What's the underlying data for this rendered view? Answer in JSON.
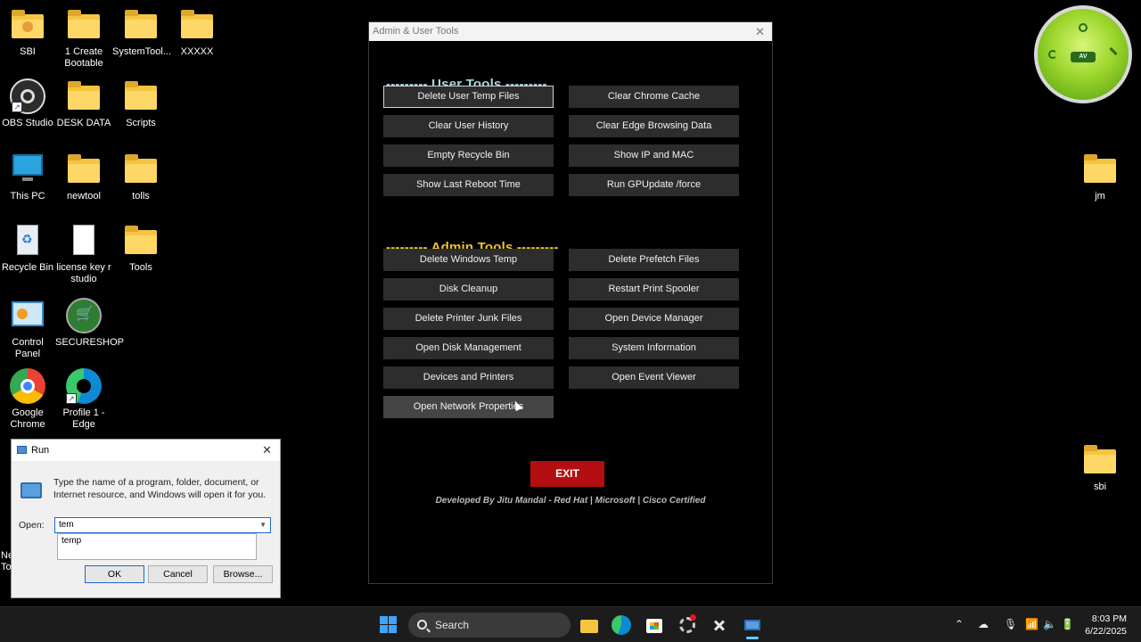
{
  "desktop": {
    "icons": [
      {
        "label": "SBI"
      },
      {
        "label": "1 Create Bootable"
      },
      {
        "label": "SystemTool..."
      },
      {
        "label": "XXXXX"
      },
      {
        "label": "OBS Studio"
      },
      {
        "label": "DESK DATA"
      },
      {
        "label": "Scripts"
      },
      {
        "label": "This PC"
      },
      {
        "label": "newtool"
      },
      {
        "label": "tolls"
      },
      {
        "label": "Recycle Bin"
      },
      {
        "label": "license key r studio"
      },
      {
        "label": "Tools"
      },
      {
        "label": "Control Panel"
      },
      {
        "label": "SECURESHOP"
      },
      {
        "label": "Google Chrome"
      },
      {
        "label": "Profile 1 - Edge"
      },
      {
        "label": "jm"
      },
      {
        "label": "sbi"
      },
      {
        "label": "Ne To"
      }
    ]
  },
  "gadget": {
    "badge": "AV"
  },
  "tool_window": {
    "title": "Admin & User Tools",
    "user_section": "--------- User Tools ---------",
    "admin_section": "--------- Admin Tools ---------",
    "user_buttons": [
      "Delete User Temp Files",
      "Clear Chrome Cache",
      "Clear User History",
      "Clear Edge Browsing Data",
      "Empty Recycle Bin",
      "Show IP and MAC",
      "Show Last Reboot Time",
      "Run GPUpdate /force"
    ],
    "admin_buttons": [
      "Delete Windows Temp",
      "Delete Prefetch Files",
      "Disk Cleanup",
      "Restart Print Spooler",
      "Delete Printer Junk Files",
      "Open Device Manager",
      "Open Disk Management",
      "System Information",
      "Devices and Printers",
      "Open Event Viewer",
      "Open Network Properties"
    ],
    "exit_label": "EXIT",
    "credits": "Developed By Jitu Mandal - Red Hat | Microsoft | Cisco Certified",
    "colors": {
      "user_heading": "#a9d6e8",
      "admin_heading": "#f2c230",
      "exit": "#b30f12"
    }
  },
  "run_dialog": {
    "title": "Run",
    "description": "Type the name of a program, folder, document, or Internet resource, and Windows will open it for you.",
    "open_label": "Open:",
    "input_value": "tem",
    "suggestion": "temp",
    "ok_label": "OK",
    "cancel_label": "Cancel",
    "browse_label": "Browse..."
  },
  "taskbar": {
    "search_label": "Search",
    "time": "8:03 PM",
    "date": "6/22/2025"
  }
}
